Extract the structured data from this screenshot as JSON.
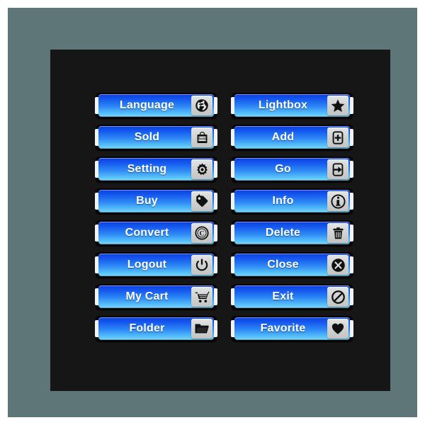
{
  "colors": {
    "page_background": "#ffffff",
    "frame": "#5f7679",
    "panel": "#161616",
    "button_blue_top": "#0b3fe0",
    "button_blue_bottom": "#7fd6fa",
    "button_outline": "#050505",
    "notch": "#f2f3f4",
    "icon_box": "#d3d5d5",
    "icon_glyph": "#111111",
    "label_text": "#ffffff"
  },
  "panel": {
    "columns": [
      {
        "name": "left-column",
        "buttons": [
          {
            "label": "Language",
            "icon": "globe-icon"
          },
          {
            "label": "Sold",
            "icon": "sold-bag-icon"
          },
          {
            "label": "Setting",
            "icon": "gear-icon"
          },
          {
            "label": "Buy",
            "icon": "price-tag-icon"
          },
          {
            "label": "Convert",
            "icon": "copyright-icon"
          },
          {
            "label": "Logout",
            "icon": "power-icon"
          },
          {
            "label": "My Cart",
            "icon": "shopping-cart-icon"
          },
          {
            "label": "Folder",
            "icon": "folder-icon"
          }
        ]
      },
      {
        "name": "right-column",
        "buttons": [
          {
            "label": "Lightbox",
            "icon": "star-icon"
          },
          {
            "label": "Add",
            "icon": "add-door-icon"
          },
          {
            "label": "Go",
            "icon": "arrow-door-icon"
          },
          {
            "label": "Info",
            "icon": "info-circle-icon"
          },
          {
            "label": "Delete",
            "icon": "trash-icon"
          },
          {
            "label": "Close",
            "icon": "close-circle-icon"
          },
          {
            "label": "Exit",
            "icon": "no-entry-icon"
          },
          {
            "label": "Favorite",
            "icon": "heart-icon"
          }
        ]
      }
    ]
  }
}
